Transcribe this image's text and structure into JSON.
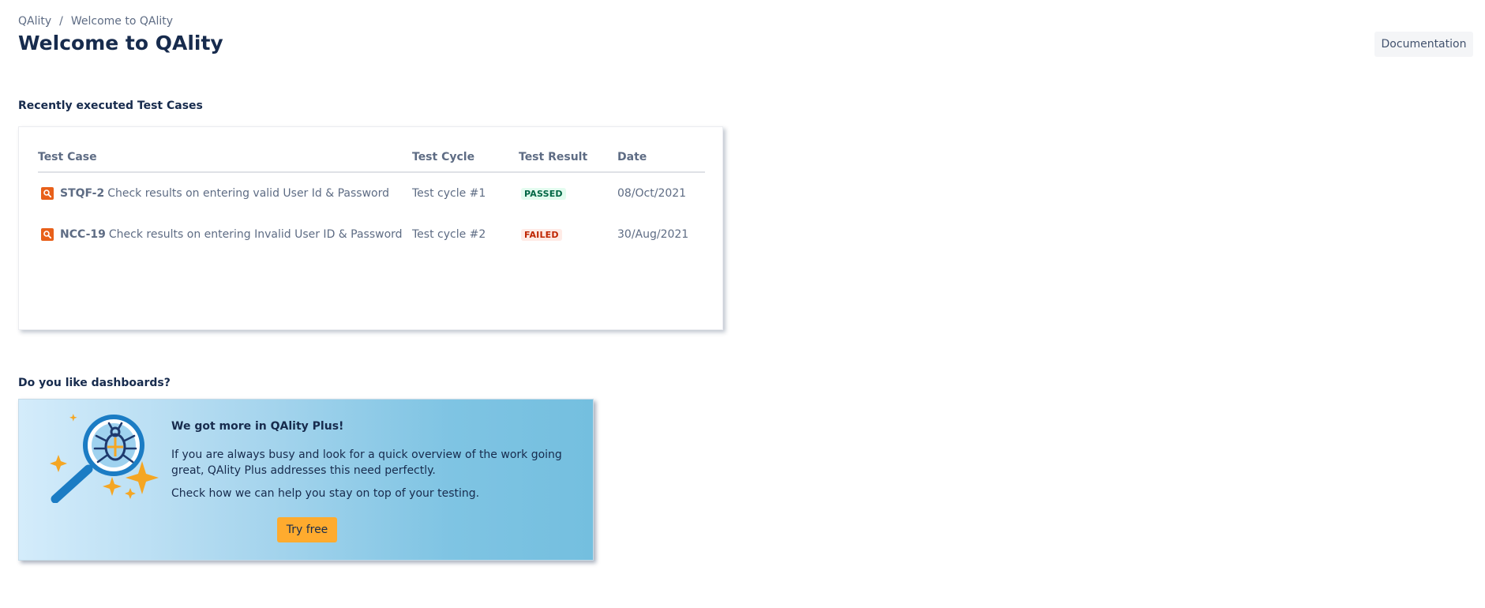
{
  "breadcrumb": {
    "root": "QAlity",
    "separator": "/",
    "current": "Welcome to QAlity"
  },
  "header": {
    "title": "Welcome to QAlity",
    "documentation_label": "Documentation"
  },
  "recent": {
    "title": "Recently executed Test Cases",
    "columns": [
      "Test Case",
      "Test Cycle",
      "Test Result",
      "Date"
    ],
    "rows": [
      {
        "key": "STQF-2",
        "name": "Check results on entering valid User Id & Password",
        "cycle": "Test cycle #1",
        "result": "PASSED",
        "date": "08/Oct/2021"
      },
      {
        "key": "NCC-19",
        "name": "Check results on entering Invalid User ID & Password",
        "cycle": "Test cycle #2",
        "result": "FAILED",
        "date": "30/Aug/2021"
      }
    ]
  },
  "dashboard": {
    "title": "Do you like dashboards?",
    "heading": "We got more in QAlity Plus!",
    "paragraph1": "If you are always busy and look for a quick overview of the work going great, QAlity Plus addresses this need perfectly.",
    "paragraph2": "Check how we can help you stay on top of your testing.",
    "cta_label": "Try free"
  },
  "colors": {
    "test_case_icon": "#e8601a",
    "passed_bg": "#e3fcef",
    "passed_text": "#006644",
    "failed_bg": "#ffebe6",
    "failed_text": "#bf2600",
    "cta_bg": "#ffab2e",
    "illustration_blue": "#1b7cc4",
    "illustration_gold": "#f5a623"
  },
  "icons": {
    "test_case": "magnifier-icon",
    "promo": "bug-magnifier-illustration"
  }
}
